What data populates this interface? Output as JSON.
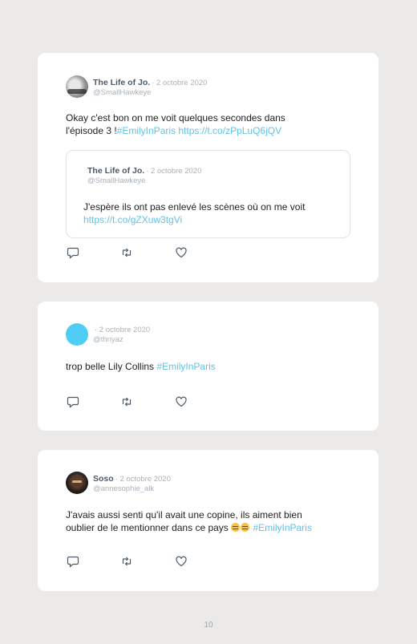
{
  "tweets": [
    {
      "author_name": "The Life of Jo.",
      "date": "· 2 octobre 2020",
      "handle": "@SmallHawkeye",
      "text_plain": "Okay c'est bon on me voit quelques secondes dans l'épisode 3 !",
      "hashtag": "#EmilyInParis",
      "link": "https://t.co/zPpLuQ6jQV",
      "quoted": {
        "author_name": "The Life of Jo.",
        "date": "· 2 octobre 2020",
        "handle": "@SmallHawkeye",
        "text_plain": "J'espère ils ont pas enlevé les scènes où on me voit",
        "link": "https://t.co/gZXuw3tgVi"
      }
    },
    {
      "author_name": "",
      "date": "· 2 octobre 2020",
      "handle": "@thnyaz",
      "text_plain": "trop belle Lily Collins",
      "hashtag": "#EmilyInParis"
    },
    {
      "author_name": "Soso",
      "date": "· 2 octobre 2020",
      "handle": "@annesophie_alk",
      "text_line1": "J'avais aussi senti qu'il avait une copine, ils aiment bien",
      "text_line2": "oublier de le mentionner dans ce pays",
      "hashtag": "#EmilyInParis"
    }
  ],
  "icons": {
    "reply": "reply-icon",
    "retweet": "retweet-icon",
    "like": "heart-icon"
  },
  "colors": {
    "page_bg": "#ebeae8",
    "card_bg": "#ffffff",
    "accent_link": "#5ec2ec",
    "name": "#4a5a6b",
    "meta": "#a7b1bb",
    "avatar2": "#4fcdf5"
  },
  "page": {
    "number": "10"
  }
}
